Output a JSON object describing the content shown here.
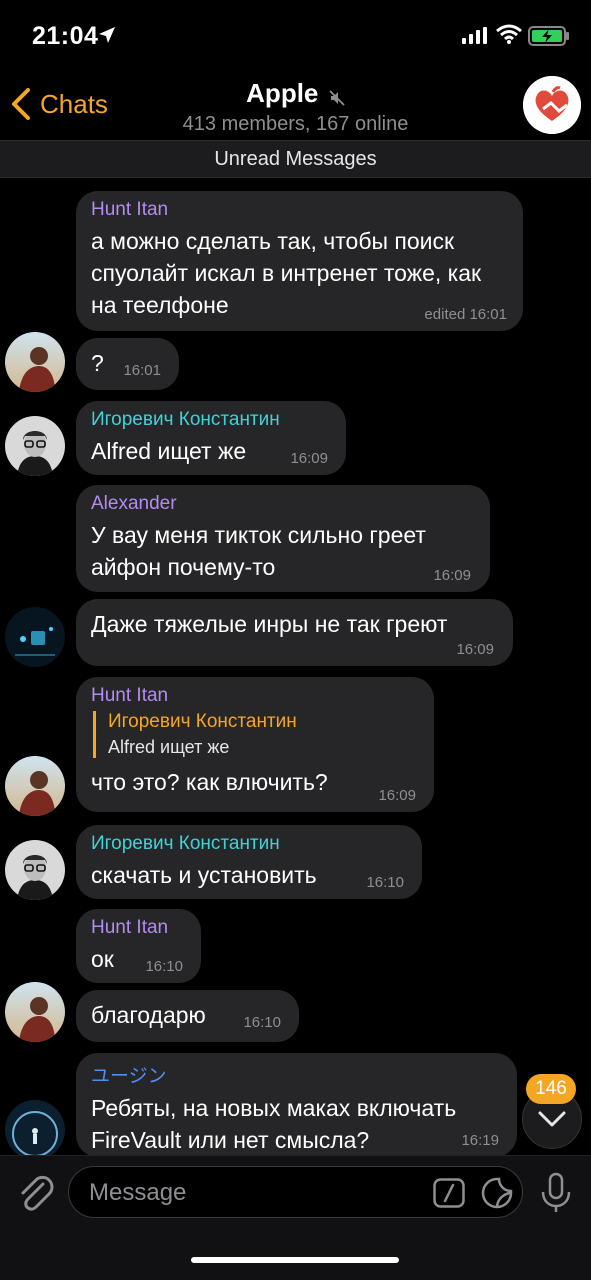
{
  "status_bar": {
    "time": "21:04"
  },
  "header": {
    "back_label": "Chats",
    "title": "Apple",
    "subtitle": "413 members, 167 online"
  },
  "unread_label": "Unread Messages",
  "messages": [
    {
      "sender": "Hunt Itan",
      "text": "а можно сделать так, чтобы поиск спуолайт искал в интренет тоже, как на  теелфоне",
      "time": "edited 16:01",
      "name_color": "#b38cf0"
    },
    {
      "sender": "",
      "text": "?",
      "time": "16:01"
    },
    {
      "sender": "Игоревич Константин",
      "text": "Alfred ищет же",
      "time": "16:09",
      "name_color": "#3ed3d9"
    },
    {
      "sender": "Alexander",
      "text": "У вау меня тикток сильно греет айфон почему-то",
      "time": "16:09",
      "name_color": "#b38cf0"
    },
    {
      "sender": "",
      "text": "Даже тяжелые инры не так греют",
      "time": "16:09"
    },
    {
      "sender": "Hunt Itan",
      "reply_to": "Игоревич Константин",
      "reply_text": "Alfred ищет же",
      "text": "что это? как влючить?",
      "time": "16:09",
      "name_color": "#b38cf0"
    },
    {
      "sender": "Игоревич Константин",
      "text": "скачать и установить",
      "time": "16:10",
      "name_color": "#3ed3d9"
    },
    {
      "sender": "Hunt Itan",
      "text": "ок",
      "time": "16:10",
      "name_color": "#b38cf0"
    },
    {
      "sender": "",
      "text": "благодарю",
      "time": "16:10"
    },
    {
      "sender": "ユージン",
      "text": "Ребяты, на новых маках включать FireVault или нет смысла?",
      "time": "16:19",
      "name_color": "#4f8ef7"
    }
  ],
  "scroll_badge": "146",
  "composer": {
    "placeholder": "Message"
  },
  "colors": {
    "accent": "#f5a623",
    "bubble": "#262628",
    "background": "#000000"
  }
}
